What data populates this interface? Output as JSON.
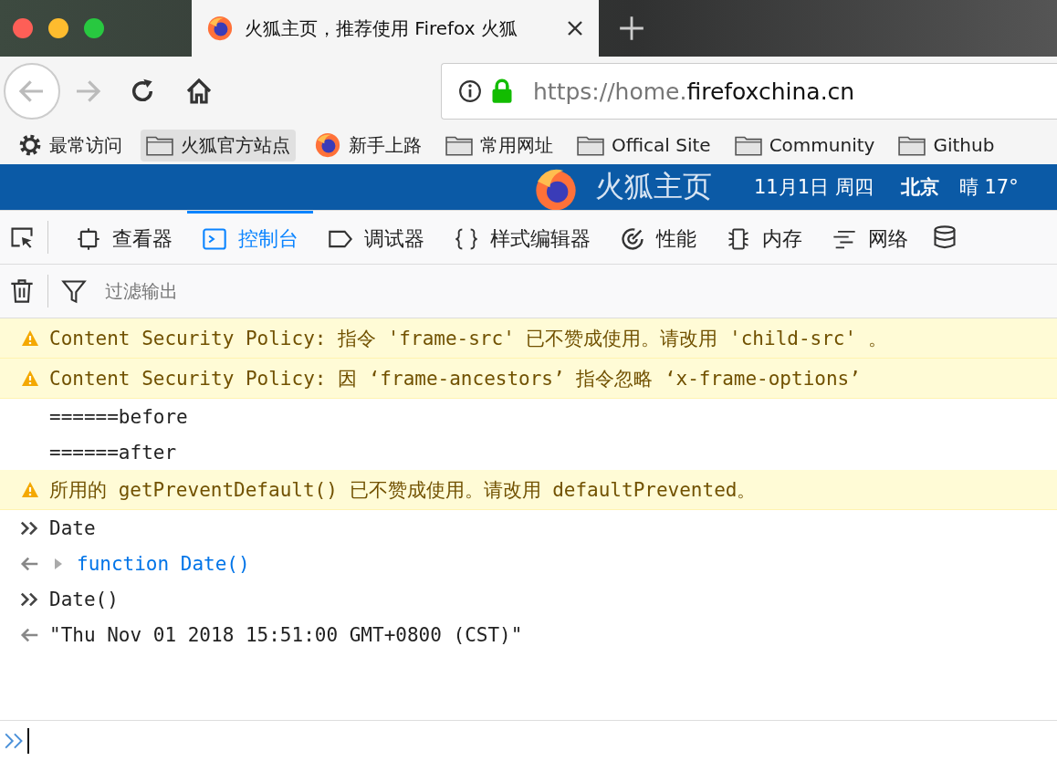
{
  "tabs": [
    {
      "title": "火狐主页，推荐使用 Firefox 火狐",
      "selected": true
    }
  ],
  "address": {
    "prefix": "https://home.",
    "host": "firefoxchina.cn"
  },
  "bookmarks": [
    {
      "label": "最常访问",
      "kind": "gear",
      "highlighted": false
    },
    {
      "label": "火狐官方站点",
      "kind": "folder",
      "highlighted": true
    },
    {
      "label": "新手上路",
      "kind": "firefox",
      "highlighted": false
    },
    {
      "label": "常用网址",
      "kind": "folder",
      "highlighted": false
    },
    {
      "label": "Offical Site",
      "kind": "folder",
      "highlighted": false
    },
    {
      "label": "Community",
      "kind": "folder",
      "highlighted": false
    },
    {
      "label": "Github",
      "kind": "folder",
      "highlighted": false
    }
  ],
  "banner": {
    "brand": "火狐主页",
    "date": "11月1日 周四",
    "city": "北京",
    "weather": "晴 17°"
  },
  "devtools_tabs": [
    {
      "label": "查看器",
      "kind": "inspector",
      "selected": false
    },
    {
      "label": "控制台",
      "kind": "console",
      "selected": true
    },
    {
      "label": "调试器",
      "kind": "debugger",
      "selected": false
    },
    {
      "label": "样式编辑器",
      "kind": "style",
      "selected": false
    },
    {
      "label": "性能",
      "kind": "performance",
      "selected": false
    },
    {
      "label": "内存",
      "kind": "memory",
      "selected": false
    },
    {
      "label": "网络",
      "kind": "network",
      "selected": false
    }
  ],
  "filter": {
    "placeholder": "过滤输出"
  },
  "messages": [
    {
      "kind": "warning",
      "text": "Content Security Policy: 指令 'frame-src' 已不赞成使用。请改用 'child-src' 。"
    },
    {
      "kind": "warning",
      "text": "Content Security Policy: 因 ‘frame-ancestors’ 指令忽略 ‘x-frame-options’"
    },
    {
      "kind": "log",
      "text": "======before"
    },
    {
      "kind": "log",
      "text": "======after"
    },
    {
      "kind": "warning",
      "text": "所用的 getPreventDefault() 已不赞成使用。请改用 defaultPrevented。"
    },
    {
      "kind": "input",
      "text": "Date"
    },
    {
      "kind": "result",
      "text": "function Date()",
      "expandable": true
    },
    {
      "kind": "input",
      "text": "Date()"
    },
    {
      "kind": "result",
      "text": "\"Thu Nov 01 2018 15:51:00 GMT+0800 (CST)\"",
      "expandable": false
    }
  ]
}
